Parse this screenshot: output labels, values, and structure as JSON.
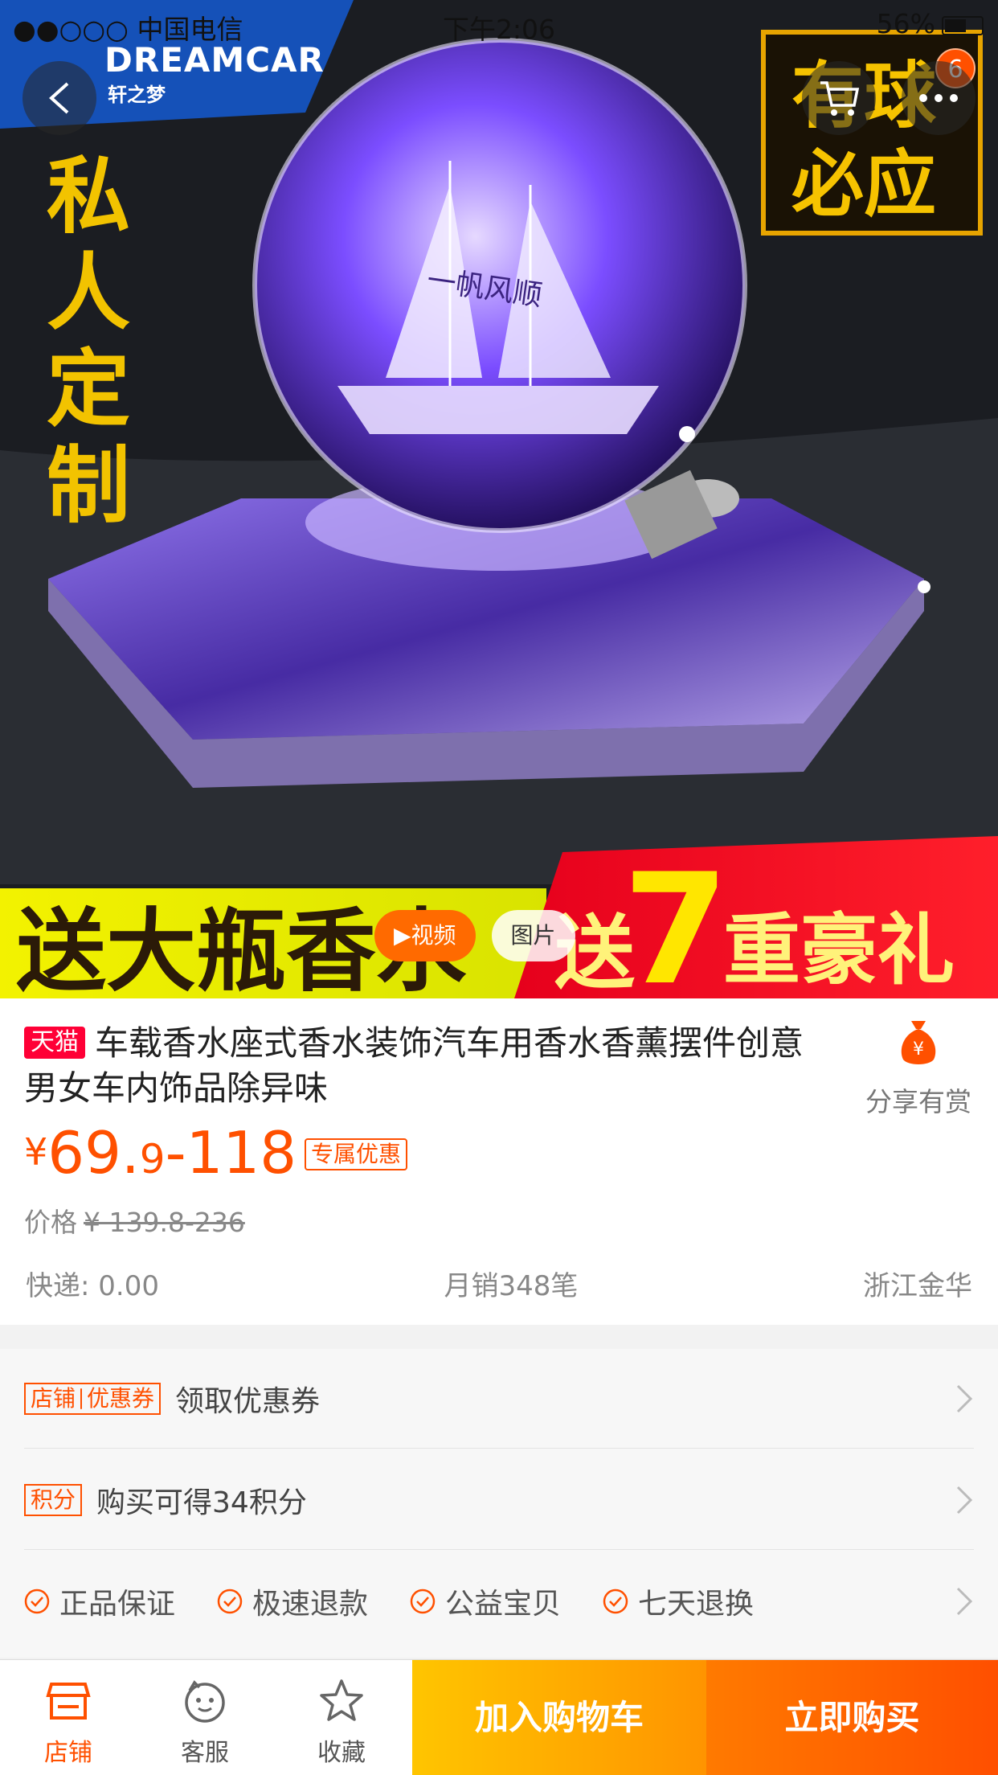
{
  "status_bar": {
    "carrier": "●●○○○ 中国电信",
    "time": "下午2:06",
    "battery": "56%"
  },
  "hero": {
    "brand_name": "DREAMCAR",
    "brand_sub": "轩之梦",
    "left_slogan": "私人定制",
    "right_stamp_line1": "有球",
    "right_stamp_line2": "必应",
    "ball_text": "一帆风顺",
    "banner_left": "送大瓶香水",
    "banner_right_prefix": "送",
    "banner_right_number": "7",
    "banner_right_suffix": "重豪礼"
  },
  "nav": {
    "cart_badge": "6"
  },
  "media_tabs": {
    "video": "▶视频",
    "photo": "图片"
  },
  "product": {
    "platform_tag": "天猫",
    "title": "车载香水座式香水装饰汽车用香水香薰摆件创意男女车内饰品除异味",
    "share_label": "分享有赏",
    "price_currency": "¥",
    "price_int": "69.",
    "price_dec": "9",
    "price_high": "-118",
    "exclusive_tag": "专属优惠",
    "original_label": "价格",
    "original_price": "¥ 139.8-236",
    "shipping": "快递: 0.00",
    "monthly_sales": "月销348笔",
    "location": "浙江金华"
  },
  "rows": {
    "coupon_tag_a": "店铺",
    "coupon_tag_b": "优惠券",
    "coupon_label": "领取优惠券",
    "points_tag": "积分",
    "points_label": "购买可得34积分",
    "guarantees": [
      "正品保证",
      "极速退款",
      "公益宝贝",
      "七天退换"
    ]
  },
  "bottom_bar": {
    "store": "店铺",
    "service": "客服",
    "favorite": "收藏",
    "add_to_cart": "加入购物车",
    "buy_now": "立即购买"
  },
  "colors": {
    "accent": "#ff5000",
    "tmall": "#ff0036",
    "cart_btn": "#ffa000",
    "buy_btn": "#ff5a00"
  }
}
